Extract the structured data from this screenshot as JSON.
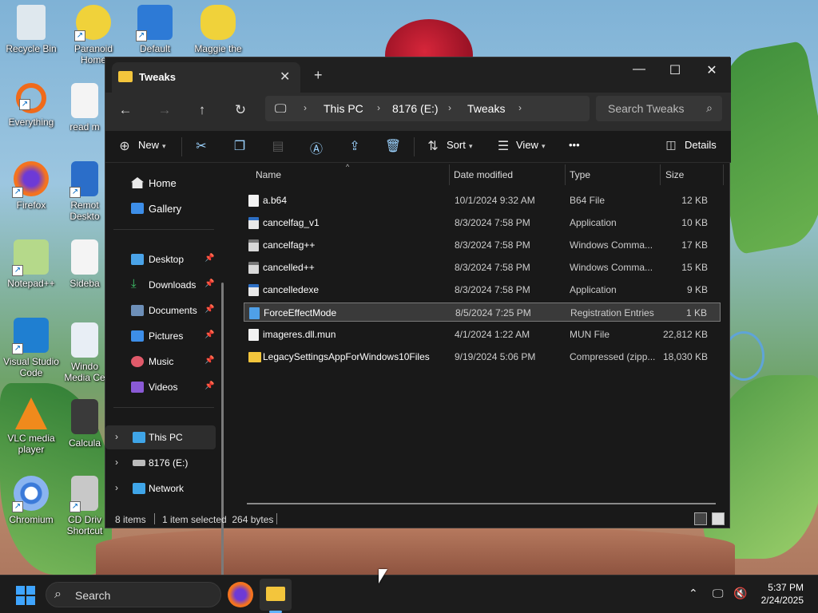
{
  "desktop": {
    "icons": [
      {
        "label": "Recycle Bin"
      },
      {
        "label": "Paranoid Home"
      },
      {
        "label": "Default"
      },
      {
        "label": "Maggie the"
      },
      {
        "label": "Everything"
      },
      {
        "label": "read m"
      },
      {
        "label": "Firefox"
      },
      {
        "label": "Remot Deskto"
      },
      {
        "label": "Notepad++"
      },
      {
        "label": "Sideba"
      },
      {
        "label": "Visual Studio Code"
      },
      {
        "label": "Windo Media Ce"
      },
      {
        "label": "VLC media player"
      },
      {
        "label": "Calcula"
      },
      {
        "label": "Chromium"
      },
      {
        "label": "CD Driv Shortcut"
      }
    ]
  },
  "window": {
    "tab_title": "Tweaks",
    "tab_close": "✕",
    "new_tab": "+",
    "controls": {
      "minimize": "—",
      "maximize": "☐",
      "close": "✕"
    },
    "address": {
      "crumbs": [
        "This PC",
        "8176 (E:)",
        "Tweaks"
      ],
      "search_placeholder": "Search Tweaks"
    },
    "commands": {
      "new": "New",
      "sort": "Sort",
      "view": "View",
      "more": "•••",
      "details": "Details"
    },
    "nav": {
      "home": "Home",
      "gallery": "Gallery",
      "quick": [
        {
          "label": "Desktop"
        },
        {
          "label": "Downloads"
        },
        {
          "label": "Documents"
        },
        {
          "label": "Pictures"
        },
        {
          "label": "Music"
        },
        {
          "label": "Videos"
        }
      ],
      "tree": [
        {
          "label": "This PC"
        },
        {
          "label": "8176 (E:)"
        },
        {
          "label": "Network"
        }
      ]
    },
    "columns": {
      "name": "Name",
      "date": "Date modified",
      "type": "Type",
      "size": "Size"
    },
    "files": [
      {
        "name": "a.b64",
        "date": "10/1/2024 9:32 AM",
        "type": "B64 File",
        "size": "12 KB",
        "icon": "file"
      },
      {
        "name": "cancelfag_v1",
        "date": "8/3/2024 7:58 PM",
        "type": "Application",
        "size": "10 KB",
        "icon": "app"
      },
      {
        "name": "cancelfag++",
        "date": "8/3/2024 7:58 PM",
        "type": "Windows Comma...",
        "size": "17 KB",
        "icon": "cmd"
      },
      {
        "name": "cancelled++",
        "date": "8/3/2024 7:58 PM",
        "type": "Windows Comma...",
        "size": "15 KB",
        "icon": "cmd"
      },
      {
        "name": "cancelledexe",
        "date": "8/3/2024 7:58 PM",
        "type": "Application",
        "size": "9 KB",
        "icon": "app"
      },
      {
        "name": "ForceEffectMode",
        "date": "8/5/2024 7:25 PM",
        "type": "Registration Entries",
        "size": "1 KB",
        "icon": "reg"
      },
      {
        "name": "imageres.dll.mun",
        "date": "4/1/2024 1:22 AM",
        "type": "MUN File",
        "size": "22,812 KB",
        "icon": "file"
      },
      {
        "name": "LegacySettingsAppForWindows10Files",
        "date": "9/19/2024 5:06 PM",
        "type": "Compressed (zipp...",
        "size": "18,030 KB",
        "icon": "zip"
      }
    ],
    "status": {
      "count": "8 items",
      "selected": "1 item selected  264 bytes"
    }
  },
  "taskbar": {
    "search": "Search",
    "time": "5:37 PM",
    "date": "2/24/2025"
  },
  "colors": {
    "accent": "#5fb2ff",
    "folder": "#f3c53c",
    "window_bg": "#191919"
  }
}
